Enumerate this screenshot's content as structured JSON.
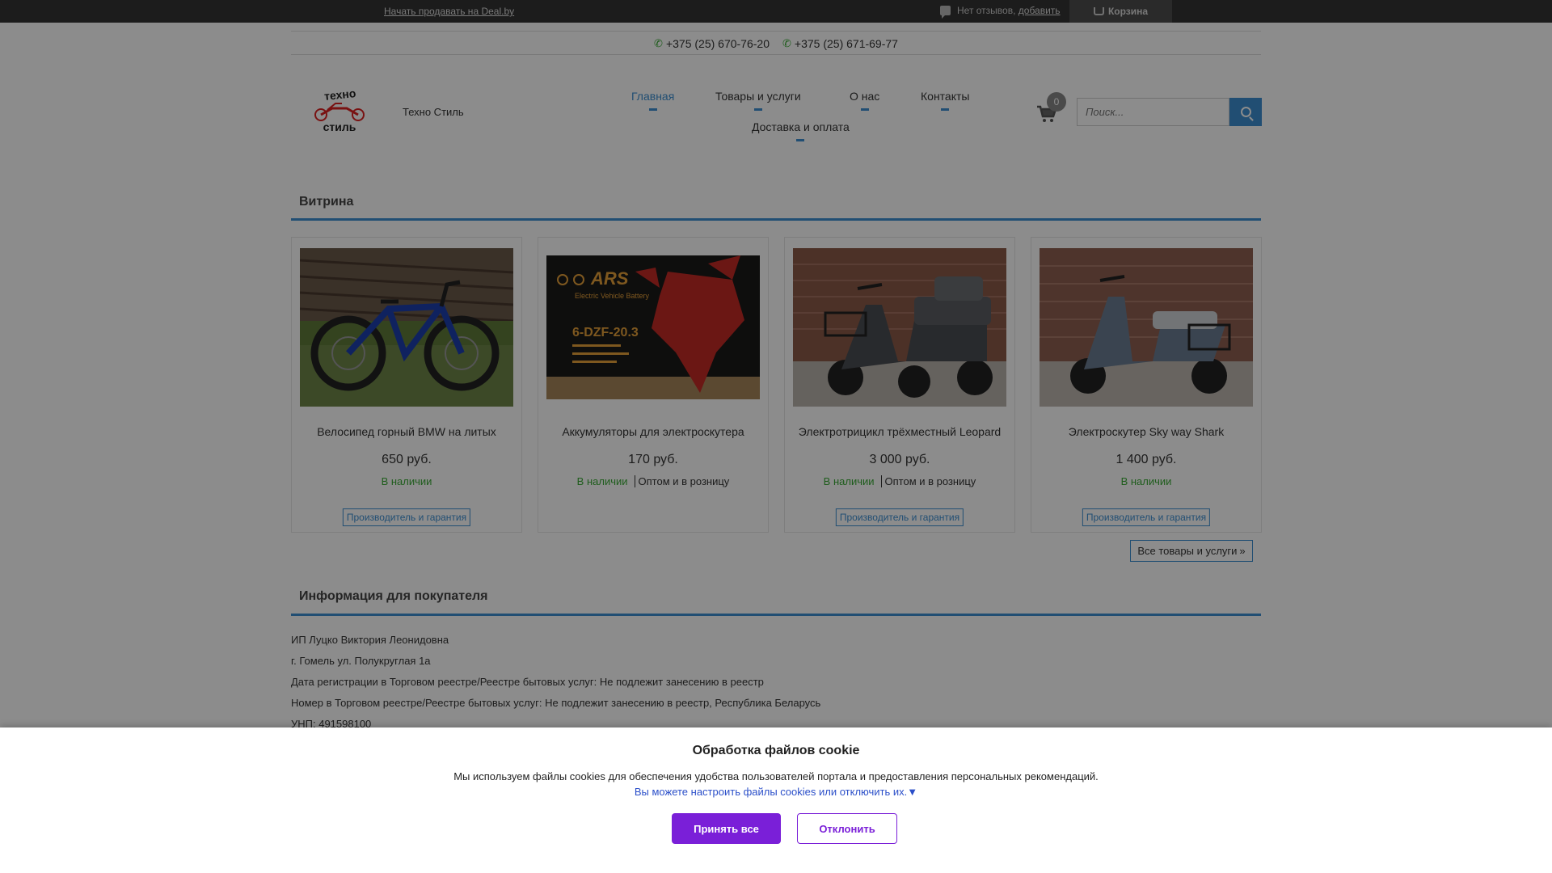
{
  "topbar": {
    "sell_link": "Начать продавать на Deal.by",
    "reviews_text": "Нет отзывов,",
    "reviews_add": "добавить",
    "cart_label": "Корзина"
  },
  "phones": [
    "+375 (25) 670-76-20",
    "+375 (25) 671-69-77"
  ],
  "header": {
    "logo_top": "техно",
    "logo_bottom": "стиль",
    "site_name": "Техно Стиль",
    "cart_count": "0",
    "search_placeholder": "Поиск..."
  },
  "nav": [
    {
      "label": "Главная",
      "active": true
    },
    {
      "label": "Товары и услуги",
      "active": false
    },
    {
      "label": "О нас",
      "active": false
    },
    {
      "label": "Контакты",
      "active": false
    },
    {
      "label": "Доставка и оплата",
      "active": false
    }
  ],
  "showcase": {
    "title": "Витрина",
    "products": [
      {
        "name": "Велосипед горный BMW на литых",
        "price": "650 руб.",
        "stock": "В наличии",
        "wholesale": "",
        "maker_button": "Производитель и гарантия"
      },
      {
        "name": "Аккумуляторы для электроскутера",
        "price": "170 руб.",
        "stock": "В наличии",
        "wholesale": "Оптом и в розницу",
        "maker_button": "",
        "battery_brand": "ARS",
        "battery_sub": "Electric Vehicle Battery",
        "battery_model": "6-DZF-20.3"
      },
      {
        "name": "Электротрицикл трёхместный Leopard",
        "price": "3 000 руб.",
        "stock": "В наличии",
        "wholesale": "Оптом и в розницу",
        "maker_button": "Производитель и гарантия"
      },
      {
        "name": "Электроскутер Sky way Shark",
        "price": "1 400 руб.",
        "stock": "В наличии",
        "wholesale": "",
        "maker_button": "Производитель и гарантия"
      }
    ],
    "all_products": "Все товары и услуги"
  },
  "buyer_info": {
    "title": "Информация для покупателя",
    "lines": [
      "ИП Луцко Виктория Леонидовна",
      "г. Гомель ул. Полукруглая 1а",
      "Дата регистрации в Торговом реестре/Реестре бытовых услуг: Не подлежит занесению в реестр",
      "Номер в Торговом реестре/Реестре бытовых услуг: Не подлежит занесению в реестр, Республика Беларусь",
      "УНП: 491598100"
    ]
  },
  "cookie": {
    "title": "Обработка файлов cookie",
    "text": "Мы используем файлы cookies для обеспечения удобства пользователей портала и предоставления персональных рекомендаций.",
    "link": "Вы можете настроить файлы cookies или отключить их.",
    "accept": "Принять все",
    "decline": "Отклонить"
  },
  "colors": {
    "accent": "#3d8fd1",
    "in_stock": "#3aaa35",
    "cookie_button": "#7a1fd8",
    "topbar": "#333333"
  }
}
